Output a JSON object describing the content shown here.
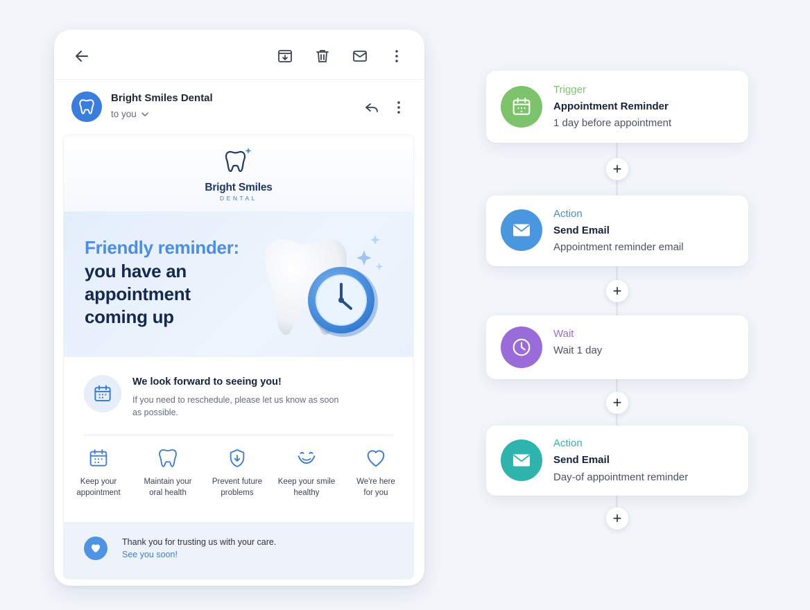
{
  "email": {
    "sender_name": "Bright Smiles Dental",
    "to_label": "to you",
    "logo": {
      "name": "Bright Smiles",
      "sub": "DENTAL"
    },
    "hero": {
      "line1": "Friendly reminder:",
      "line2": "you have an appointment coming up"
    },
    "notice": {
      "title": "We look forward to seeing you!",
      "text": "If you need to reschedule, please let us know as soon as possible."
    },
    "features": [
      {
        "icon": "calendar-icon",
        "label": "Keep your\nappointment"
      },
      {
        "icon": "tooth-icon",
        "label": "Maintain your\noral health"
      },
      {
        "icon": "shield-icon",
        "label": "Prevent future\nproblems"
      },
      {
        "icon": "smile-icon",
        "label": "Keep your smile\nhealthy"
      },
      {
        "icon": "heart-icon",
        "label": "We're here\nfor you"
      }
    ],
    "footer": {
      "text": "Thank you for trusting us with your care.",
      "link": "See you soon!"
    }
  },
  "workflow": {
    "steps": [
      {
        "type": "Trigger",
        "title": "Appointment Reminder",
        "subtitle": "1 day before appointment",
        "color": "#7cc36b",
        "icon": "calendar-icon"
      },
      {
        "type": "Action",
        "title": "Send Email",
        "subtitle": "Appointment reminder email",
        "color": "#3f8fdc",
        "icon": "envelope-icon"
      },
      {
        "type": "Wait",
        "title": "",
        "subtitle": "Wait 1 day",
        "color": "#9a6cd9",
        "icon": "clock-icon"
      },
      {
        "type": "Action",
        "title": "Send Email",
        "subtitle": "Day-of appointment reminder",
        "color": "#2fb3ad",
        "icon": "envelope-icon"
      }
    ],
    "add_step_label": "+"
  },
  "colors": {
    "brand_blue": "#3b7ddd",
    "trigger_green": "#7cc36b",
    "action_blue": "#3f8fdc",
    "wait_purple": "#9a6cd9",
    "action_teal": "#2fb3ad"
  }
}
